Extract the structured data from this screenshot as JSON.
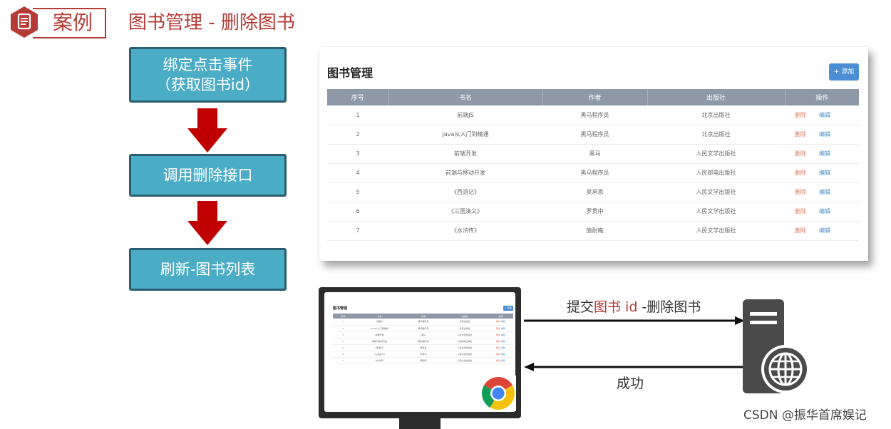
{
  "header": {
    "case_label": "案例",
    "title": "图书管理 - 删除图书"
  },
  "flow": {
    "steps": [
      {
        "line1": "绑定点击事件",
        "line2": "（获取图书id）"
      },
      {
        "line1": "调用删除接口"
      },
      {
        "line1": "刷新-图书列表"
      }
    ]
  },
  "book_panel": {
    "title": "图书管理",
    "add_button": "+ 添加",
    "columns": [
      "序号",
      "书名",
      "作者",
      "出版社",
      "操作"
    ],
    "rows": [
      {
        "id": "1",
        "name": "前端JS",
        "author": "黑马程序员",
        "publisher": "北京出版社"
      },
      {
        "id": "2",
        "name": "Java从入门到精通",
        "author": "黑马程序员",
        "publisher": "北京出版社"
      },
      {
        "id": "3",
        "name": "前端开发",
        "author": "黑马",
        "publisher": "人民文学出版社"
      },
      {
        "id": "4",
        "name": "前端与移动开发",
        "author": "黑马程序员",
        "publisher": "人民邮电出版社"
      },
      {
        "id": "5",
        "name": "《西游记》",
        "author": "吴承恩",
        "publisher": "人民文学出版社"
      },
      {
        "id": "6",
        "name": "《三国演义》",
        "author": "罗贯中",
        "publisher": "人民文学出版社"
      },
      {
        "id": "7",
        "name": "《水浒传》",
        "author": "施耐庵",
        "publisher": "人民文学出版社"
      }
    ],
    "delete_label": "删除",
    "edit_label": "编辑"
  },
  "request": {
    "prefix": "提交",
    "highlight": "图书 id",
    "suffix": " -删除图书"
  },
  "response": {
    "label": "成功"
  },
  "watermark": "CSDN @振华首席娱记",
  "colors": {
    "brand_red": "#b53b36",
    "step_fill": "#4bacc6",
    "arrow_red": "#c00000",
    "header_gray": "#8e98a6",
    "delete": "#e07c5f",
    "edit": "#4a8fd3"
  }
}
